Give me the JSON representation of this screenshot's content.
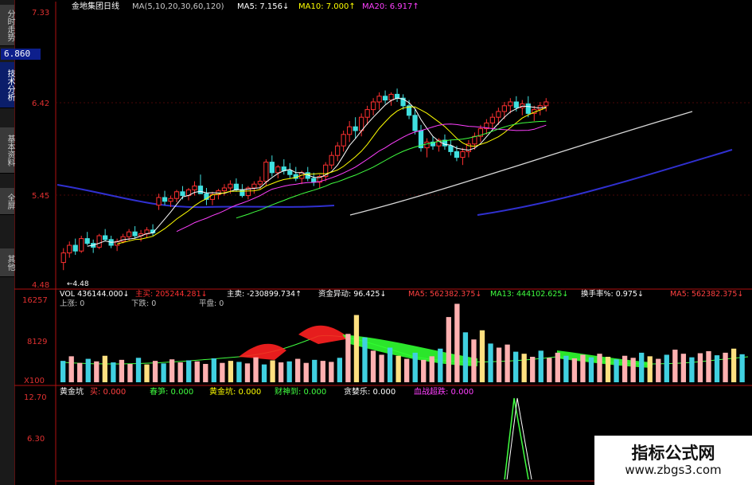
{
  "sidebar": {
    "tabs": [
      {
        "label": "分时走势",
        "active": false
      },
      {
        "label": "技术分析",
        "active": true
      },
      {
        "label": "基本资料",
        "active": false
      },
      {
        "label": "全屏",
        "active": false
      },
      {
        "label": "其他",
        "active": false
      }
    ],
    "price_badge": "6.860"
  },
  "price_panel": {
    "header": [
      {
        "text": "金地集团日线",
        "color": "#ffffff"
      },
      {
        "text": "MA(5,10,20,30,60,120)",
        "color": "#c8c8c8"
      },
      {
        "text": "MA5: 7.156↓",
        "color": "#ffffff"
      },
      {
        "text": "MA10: 7.000↑",
        "color": "#ffff00"
      },
      {
        "text": "MA20: 6.917↑",
        "color": "#ff40ff"
      }
    ],
    "y_labels": [
      "7.33",
      "6.42",
      "5.45",
      "4.48"
    ],
    "low_marker": "←4.48"
  },
  "volume_panel": {
    "header": [
      {
        "text": "VOL 436144.000↓",
        "color": "#ffffff"
      },
      {
        "text": "主买: 205244.281↓",
        "color": "#ff3030"
      },
      {
        "text": "主卖: -230899.734↑",
        "color": "#ffffff"
      },
      {
        "text": "资金异动: 96.425↓",
        "color": "#ffffff"
      },
      {
        "text": "MA5: 562382.375↓",
        "color": "#ff4040"
      },
      {
        "text": "MA13: 444102.625↓",
        "color": "#40ff40"
      },
      {
        "text": "换手率%: 0.975↓",
        "color": "#ffffff"
      },
      {
        "text": "MA5: 562382.375↓",
        "color": "#ff4040"
      }
    ],
    "sub_header": [
      "上涨: 0",
      "下跌: 0",
      "平盘: 0"
    ],
    "y_labels": [
      "16257",
      "8129",
      "X100"
    ]
  },
  "indicator_panel": {
    "header": [
      {
        "text": "黄金坑",
        "color": "#ffffff"
      },
      {
        "text": "买: 0.000",
        "color": "#ff4040"
      },
      {
        "text": "春笋: 0.000",
        "color": "#40ff40"
      },
      {
        "text": "黄金坑: 0.000",
        "color": "#ffff00"
      },
      {
        "text": "财神到: 0.000",
        "color": "#40ff40"
      },
      {
        "text": "贪婪乐: 0.000",
        "color": "#ffffff"
      },
      {
        "text": "血战超跌: 0.000",
        "color": "#ff40ff"
      }
    ],
    "y_labels": [
      "12.70",
      "6.30"
    ]
  },
  "watermark": {
    "title": "指标公式网",
    "url": "www.zbgs3.com"
  },
  "chart_data": [
    {
      "type": "candlestick",
      "title": "金地集团日线",
      "ylim": [
        4.48,
        7.33
      ],
      "y_ticks": [
        7.33,
        6.42,
        5.45,
        4.48
      ],
      "ohlc": [
        [
          4.7,
          4.85,
          4.62,
          4.8
        ],
        [
          4.8,
          4.92,
          4.75,
          4.88
        ],
        [
          4.88,
          4.95,
          4.78,
          4.82
        ],
        [
          4.82,
          4.98,
          4.8,
          4.95
        ],
        [
          4.95,
          5.02,
          4.88,
          4.9
        ],
        [
          4.9,
          4.94,
          4.8,
          4.86
        ],
        [
          4.86,
          5.0,
          4.84,
          4.98
        ],
        [
          4.98,
          5.05,
          4.92,
          4.94
        ],
        [
          4.94,
          4.98,
          4.85,
          4.88
        ],
        [
          4.88,
          4.95,
          4.82,
          4.92
        ],
        [
          4.92,
          5.0,
          4.9,
          4.97
        ],
        [
          4.97,
          5.05,
          4.93,
          5.02
        ],
        [
          5.02,
          5.08,
          4.95,
          4.98
        ],
        [
          4.98,
          5.04,
          4.92,
          5.0
        ],
        [
          5.0,
          5.07,
          4.96,
          5.04
        ],
        [
          5.04,
          5.1,
          4.98,
          5.01
        ],
        [
          5.3,
          5.42,
          5.25,
          5.38
        ],
        [
          5.38,
          5.45,
          5.3,
          5.34
        ],
        [
          5.34,
          5.4,
          5.28,
          5.37
        ],
        [
          5.37,
          5.46,
          5.33,
          5.44
        ],
        [
          5.44,
          5.5,
          5.36,
          5.4
        ],
        [
          5.4,
          5.48,
          5.35,
          5.46
        ],
        [
          5.46,
          5.55,
          5.4,
          5.5
        ],
        [
          5.5,
          5.62,
          5.45,
          5.42
        ],
        [
          5.42,
          5.48,
          5.3,
          5.36
        ],
        [
          5.36,
          5.44,
          5.3,
          5.41
        ],
        [
          5.41,
          5.47,
          5.36,
          5.45
        ],
        [
          5.45,
          5.52,
          5.4,
          5.48
        ],
        [
          5.48,
          5.56,
          5.42,
          5.52
        ],
        [
          5.52,
          5.58,
          5.44,
          5.46
        ],
        [
          5.46,
          5.52,
          5.38,
          5.4
        ],
        [
          5.4,
          5.5,
          5.36,
          5.48
        ],
        [
          5.48,
          5.55,
          5.42,
          5.52
        ],
        [
          5.52,
          5.6,
          5.46,
          5.55
        ],
        [
          5.55,
          5.78,
          5.5,
          5.75
        ],
        [
          5.75,
          5.82,
          5.6,
          5.64
        ],
        [
          5.64,
          5.72,
          5.58,
          5.7
        ],
        [
          5.7,
          5.78,
          5.62,
          5.66
        ],
        [
          5.66,
          5.74,
          5.58,
          5.62
        ],
        [
          5.62,
          5.7,
          5.55,
          5.58
        ],
        [
          5.58,
          5.66,
          5.52,
          5.64
        ],
        [
          5.64,
          5.7,
          5.55,
          5.58
        ],
        [
          5.58,
          5.64,
          5.5,
          5.54
        ],
        [
          5.54,
          5.62,
          5.48,
          5.6
        ],
        [
          5.6,
          5.75,
          5.55,
          5.72
        ],
        [
          5.72,
          5.86,
          5.68,
          5.82
        ],
        [
          5.82,
          5.96,
          5.76,
          5.92
        ],
        [
          5.92,
          6.08,
          5.86,
          6.04
        ],
        [
          6.04,
          6.18,
          5.96,
          6.12
        ],
        [
          6.12,
          6.22,
          6.0,
          6.08
        ],
        [
          6.08,
          6.26,
          6.02,
          6.22
        ],
        [
          6.22,
          6.34,
          6.14,
          6.3
        ],
        [
          6.3,
          6.42,
          6.24,
          6.38
        ],
        [
          6.38,
          6.48,
          6.3,
          6.44
        ],
        [
          6.44,
          6.5,
          6.36,
          6.4
        ],
        [
          6.4,
          6.48,
          6.34,
          6.46
        ],
        [
          6.46,
          6.52,
          6.38,
          6.42
        ],
        [
          6.42,
          6.46,
          6.3,
          6.34
        ],
        [
          6.34,
          6.4,
          6.2,
          6.24
        ],
        [
          6.24,
          6.3,
          6.04,
          6.08
        ],
        [
          6.08,
          6.14,
          5.86,
          5.9
        ],
        [
          5.9,
          6.0,
          5.8,
          5.96
        ],
        [
          5.96,
          6.02,
          5.88,
          5.92
        ],
        [
          5.92,
          6.0,
          5.86,
          5.98
        ],
        [
          5.98,
          6.04,
          5.88,
          5.92
        ],
        [
          5.92,
          5.98,
          5.82,
          5.86
        ],
        [
          5.86,
          5.92,
          5.76,
          5.8
        ],
        [
          5.8,
          5.9,
          5.72,
          5.86
        ],
        [
          5.86,
          5.98,
          5.8,
          5.94
        ],
        [
          5.94,
          6.06,
          5.88,
          6.02
        ],
        [
          6.02,
          6.14,
          5.96,
          6.1
        ],
        [
          6.1,
          6.2,
          6.04,
          6.16
        ],
        [
          6.16,
          6.26,
          6.1,
          6.22
        ],
        [
          6.22,
          6.32,
          6.14,
          6.28
        ],
        [
          6.28,
          6.38,
          6.2,
          6.34
        ],
        [
          6.34,
          6.42,
          6.26,
          6.38
        ],
        [
          6.38,
          6.44,
          6.28,
          6.32
        ],
        [
          6.32,
          6.4,
          6.24,
          6.36
        ],
        [
          6.36,
          6.44,
          6.22,
          6.26
        ],
        [
          6.26,
          6.34,
          6.18,
          6.3
        ],
        [
          6.3,
          6.38,
          6.24,
          6.34
        ],
        [
          6.34,
          6.42,
          6.28,
          6.38
        ]
      ]
    },
    {
      "type": "bar",
      "title": "VOL",
      "ylim": [
        0,
        16257
      ],
      "y_ticks": [
        16257,
        8129
      ],
      "values": [
        4200,
        5100,
        3800,
        4600,
        4100,
        5200,
        3900,
        4400,
        3600,
        4800,
        3500,
        4200,
        3700,
        4500,
        3900,
        4300,
        4100,
        3600,
        4700,
        3800,
        4200,
        4000,
        3700,
        4900,
        3500,
        4300,
        3900,
        4100,
        4600,
        3800,
        4400,
        4200,
        4000,
        4800,
        9500,
        13200,
        8800,
        6200,
        5400,
        6800,
        5200,
        4600,
        5800,
        4400,
        5100,
        6600,
        12800,
        15400,
        9800,
        8400,
        10200,
        7600,
        6800,
        7400,
        6000,
        5600,
        5000,
        6200,
        4800,
        5800,
        5200,
        4700,
        5400,
        4900,
        5600,
        5000,
        4500,
        5200,
        4800,
        5800,
        5100,
        4600,
        5400,
        6400,
        5600,
        4900,
        5700,
        6100,
        5300,
        5800,
        6600,
        5500
      ]
    },
    {
      "type": "line",
      "title": "黄金坑",
      "ylim": [
        0,
        12.7
      ],
      "y_ticks": [
        12.7,
        6.3
      ],
      "values": [
        0,
        0,
        0,
        0,
        0,
        0,
        0,
        0,
        0,
        0,
        0,
        0,
        0,
        0,
        0,
        0,
        0,
        0,
        0,
        0,
        0,
        0,
        0,
        0,
        0,
        0,
        0,
        0,
        0,
        0,
        0,
        0,
        0,
        0,
        0,
        0,
        0,
        0,
        0,
        0,
        0,
        0,
        0,
        0,
        0,
        0,
        0,
        0,
        0,
        0,
        0,
        0,
        0,
        0,
        0,
        0,
        0,
        0,
        0,
        0,
        0,
        0,
        0,
        0,
        0,
        0,
        0,
        0,
        0,
        0,
        0,
        0,
        0,
        0,
        0,
        0,
        0,
        0,
        0,
        0,
        0,
        0
      ],
      "spike": {
        "index_start": 54,
        "index_peak": 56,
        "index_end": 58,
        "peak": 12.7
      }
    }
  ]
}
